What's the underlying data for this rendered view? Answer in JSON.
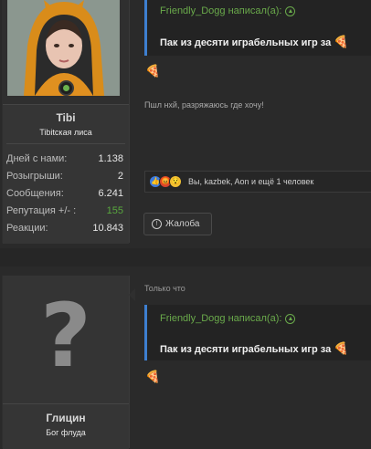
{
  "post1": {
    "user": {
      "name": "Tibi",
      "title": "Tibitская лиса"
    },
    "stats": [
      {
        "label": "Дней с нами:",
        "value": "1.138"
      },
      {
        "label": "Розыгрыши:",
        "value": "2"
      },
      {
        "label": "Сообщения:",
        "value": "6.241"
      },
      {
        "label": "Репутация +/- :",
        "value": "155"
      },
      {
        "label": "Реакции:",
        "value": "10.843"
      }
    ],
    "quote": {
      "author": "Friendly_Dogg написал(а):",
      "text": "Пак из десяти играбельных игр за"
    },
    "message": "Пшл нхй, разряжаюсь где хочу!",
    "reactions": "Вы, kazbek, Aon и ещё 1 человек",
    "report_label": "Жалоба",
    "colors": {
      "quote_border": "#3d7fd0",
      "quote_author": "#6aaa4b",
      "reputation": "#59a83e",
      "online": "#6bb24e"
    }
  },
  "post2": {
    "user": {
      "name": "Глицин",
      "title": "Бог флуда"
    },
    "time": "Только что",
    "quote": {
      "author": "Friendly_Dogg написал(а):",
      "text": "Пак из десяти играбельных игр за"
    }
  },
  "icons": {
    "emoji": "pizza-icon",
    "expand": "arrow-up-circle-icon",
    "report": "exclamation-circle-icon"
  }
}
